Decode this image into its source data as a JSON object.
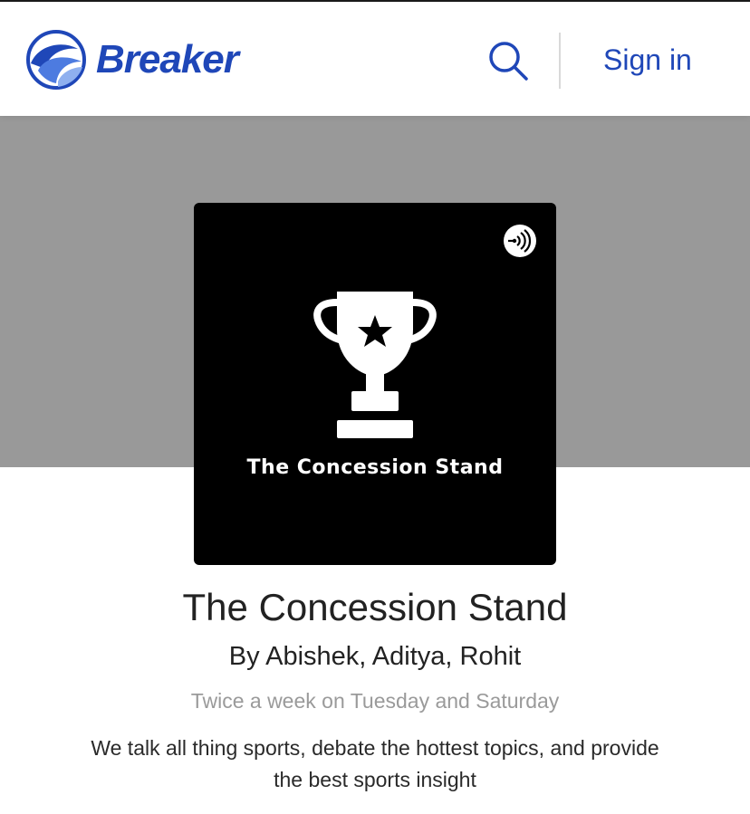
{
  "header": {
    "logo_text": "Breaker",
    "signin_label": "Sign in",
    "accent_color": "#1f47b8"
  },
  "podcast": {
    "cover_title": "The Concession Stand",
    "title": "The Concession Stand",
    "authors": "By Abishek, Aditya, Rohit",
    "schedule": "Twice a week on Tuesday and Saturday",
    "description": "We talk all thing sports, debate the hottest topics, and provide the best sports insight"
  },
  "icons": {
    "logo": "breaker-wave-icon",
    "search": "search-icon",
    "badge": "podcast-broadcast-icon",
    "artwork": "trophy-icon"
  },
  "colors": {
    "hero_background": "#999999",
    "cover_background": "#000000",
    "text_muted": "#9a9a9a"
  }
}
